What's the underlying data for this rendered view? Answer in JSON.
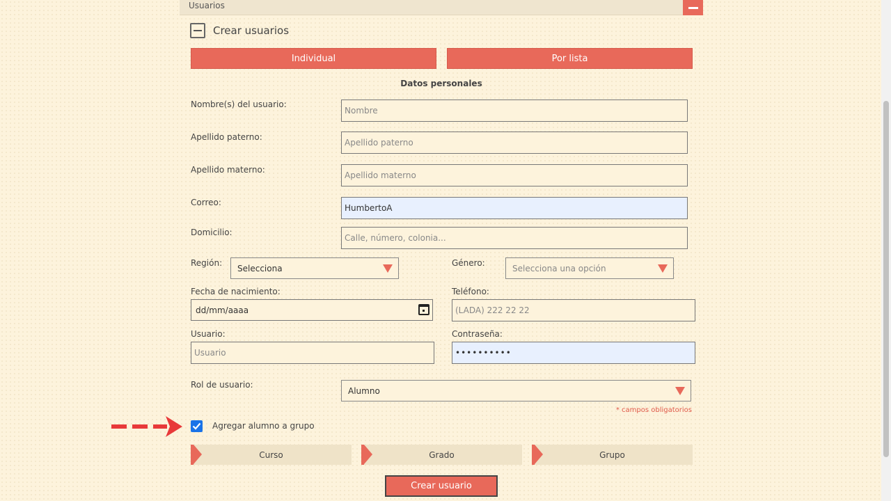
{
  "panel": {
    "title": "Usuarios"
  },
  "section": {
    "title": "Crear usuarios"
  },
  "tabs": [
    {
      "label": "Individual"
    },
    {
      "label": "Por lista"
    }
  ],
  "form": {
    "subheading": "Datos personales",
    "nombre": {
      "label": "Nombre(s) del usuario:",
      "placeholder": "Nombre",
      "value": ""
    },
    "paterno": {
      "label": "Apellido paterno:",
      "placeholder": "Apellido paterno",
      "value": ""
    },
    "materno": {
      "label": "Apellido materno:",
      "placeholder": "Apellido materno",
      "value": ""
    },
    "correo": {
      "label": "Correo:",
      "placeholder": "",
      "value": "HumbertoA"
    },
    "domicilio": {
      "label": "Domicilio:",
      "placeholder": "Calle, número, colonia...",
      "value": ""
    },
    "region": {
      "label": "Región:",
      "selected": "Selecciona"
    },
    "genero": {
      "label": "Género:",
      "selected": "Selecciona una opción"
    },
    "fecha": {
      "label": "Fecha de nacimiento:",
      "value": "dd/mm/aaaa"
    },
    "telefono": {
      "label": "Teléfono:",
      "placeholder": "(LADA) 222 22 22",
      "value": ""
    },
    "usuario": {
      "label": "Usuario:",
      "placeholder": "Usuario",
      "value": ""
    },
    "contrasena": {
      "label": "Contraseña:",
      "value": "••••••••••"
    },
    "rol": {
      "label": "Rol de usuario:",
      "selected": "Alumno"
    },
    "required_note": "* campos obligatorios",
    "add_to_group": {
      "label": "Agregar alumno a grupo",
      "checked": true
    },
    "steps": [
      {
        "label": "Curso"
      },
      {
        "label": "Grado"
      },
      {
        "label": "Grupo"
      }
    ],
    "submit_label": "Crear usuario"
  },
  "colors": {
    "accent": "#e8695a",
    "background": "#fdf3dc",
    "autofill": "#e8f0fe",
    "checkbox": "#1a73e8"
  }
}
